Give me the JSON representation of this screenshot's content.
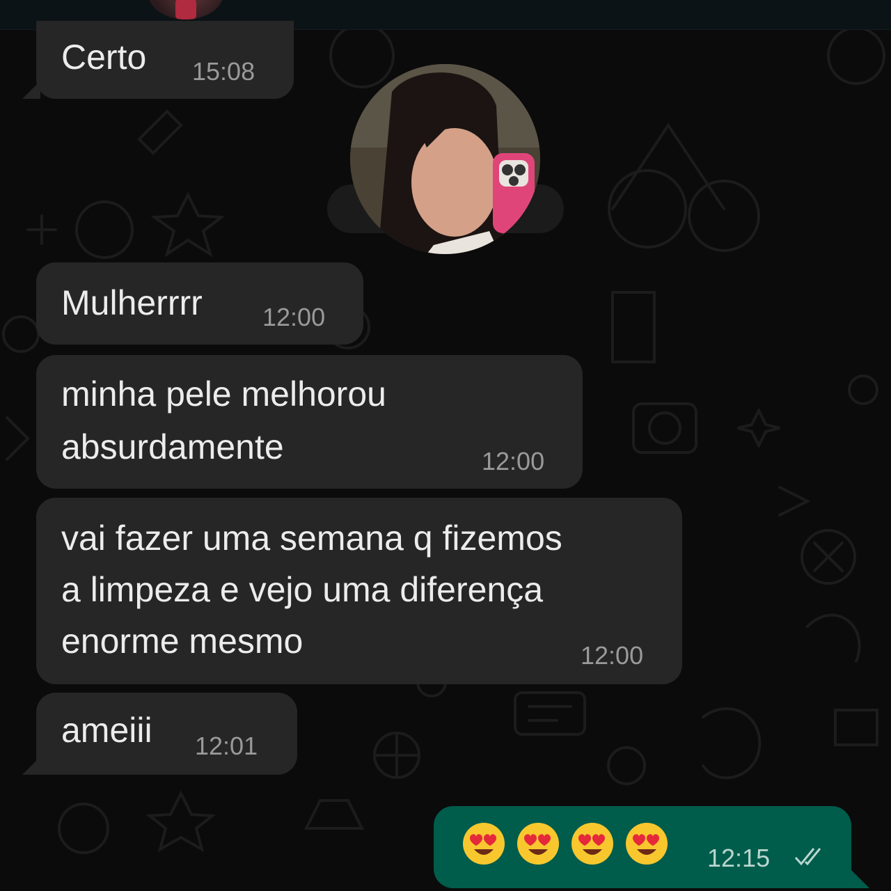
{
  "messages": [
    {
      "text": "Certo",
      "time": "15:08"
    },
    {
      "text": "Mulherrrr",
      "time": "12:00"
    },
    {
      "text_lines": [
        "minha pele melhorou",
        "absurdamente"
      ],
      "time": "12:00"
    },
    {
      "text_lines": [
        "vai fazer uma semana q fizemos",
        "a limpeza e vejo uma diferença",
        "enorme mesmo"
      ],
      "time": "12:00"
    },
    {
      "text": "ameiii",
      "time": "12:01"
    }
  ],
  "outgoing": {
    "emojis": [
      "smiling-face-with-heart-eyes",
      "smiling-face-with-heart-eyes",
      "smiling-face-with-heart-eyes",
      "smiling-face-with-heart-eyes"
    ],
    "time": "12:15",
    "status_icon": "read-double-check-icon"
  },
  "colors": {
    "background": "#0b0b0b",
    "incoming_bubble": "#262626",
    "outgoing_bubble": "#005c4b",
    "timestamp": "#9a9a9a"
  }
}
